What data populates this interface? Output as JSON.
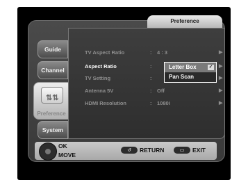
{
  "header": {
    "title": "Preference"
  },
  "tabs": [
    {
      "id": "guide",
      "label": "Guide"
    },
    {
      "id": "channel",
      "label": "Channel"
    },
    {
      "id": "preference",
      "label": "Preference"
    },
    {
      "id": "system",
      "label": "System"
    }
  ],
  "menu": [
    {
      "label": "TV Aspect Ratio",
      "value": "4 : 3"
    },
    {
      "label": "Aspect Ratio",
      "value": ""
    },
    {
      "label": "TV Setting",
      "value": ""
    },
    {
      "label": "Antenna 5V",
      "value": "Off"
    },
    {
      "label": "HDMI Resolution",
      "value": "1080i"
    }
  ],
  "dropdown": {
    "options": [
      {
        "label": "Letter Box",
        "selected": true
      },
      {
        "label": "Pan Scan",
        "selected": false
      }
    ]
  },
  "footer": {
    "ok": "OK",
    "move": "MOVE",
    "return_label": "RETURN",
    "exit_label": "EXIT"
  },
  "icons": {
    "remote": "remote-dpad-icon",
    "return": "return-button-icon",
    "exit": "exit-button-icon"
  }
}
